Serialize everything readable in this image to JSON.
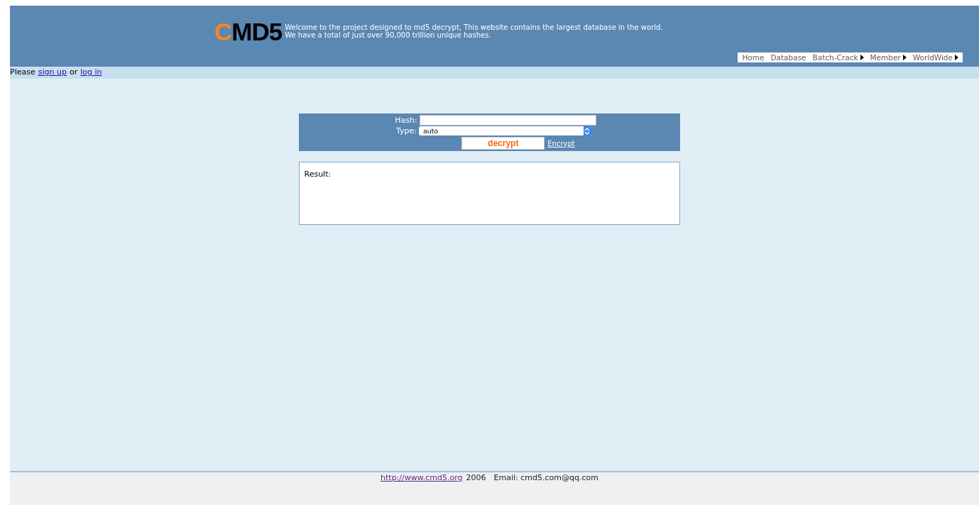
{
  "header": {
    "logo": {
      "accent": "C",
      "rest": "MD5"
    },
    "tagline": [
      "Welcome to the project designed to md5 decrypt, This website contains the largest database in the world.",
      "We have a total of just over 90,000 trillion unique hashes."
    ],
    "nav": [
      {
        "label": "Home",
        "submenu": false
      },
      {
        "label": "Database",
        "submenu": false
      },
      {
        "label": "Batch-Crack",
        "submenu": true
      },
      {
        "label": "Member",
        "submenu": true
      },
      {
        "label": "WorldWide",
        "submenu": true
      }
    ]
  },
  "login_bar": {
    "before": "Please",
    "signup": "sign up",
    "middle": "or",
    "login": "log in"
  },
  "form": {
    "hash_label": "Hash:",
    "type_label": "Type:",
    "type_value": "auto",
    "decrypt": "decrypt",
    "encrypt": "Encrypt"
  },
  "result": {
    "label": "Result:"
  },
  "footer": {
    "link": "http://www.cmd5.org",
    "year": "2006",
    "email": "Email: cmd5.com@qq.com"
  }
}
